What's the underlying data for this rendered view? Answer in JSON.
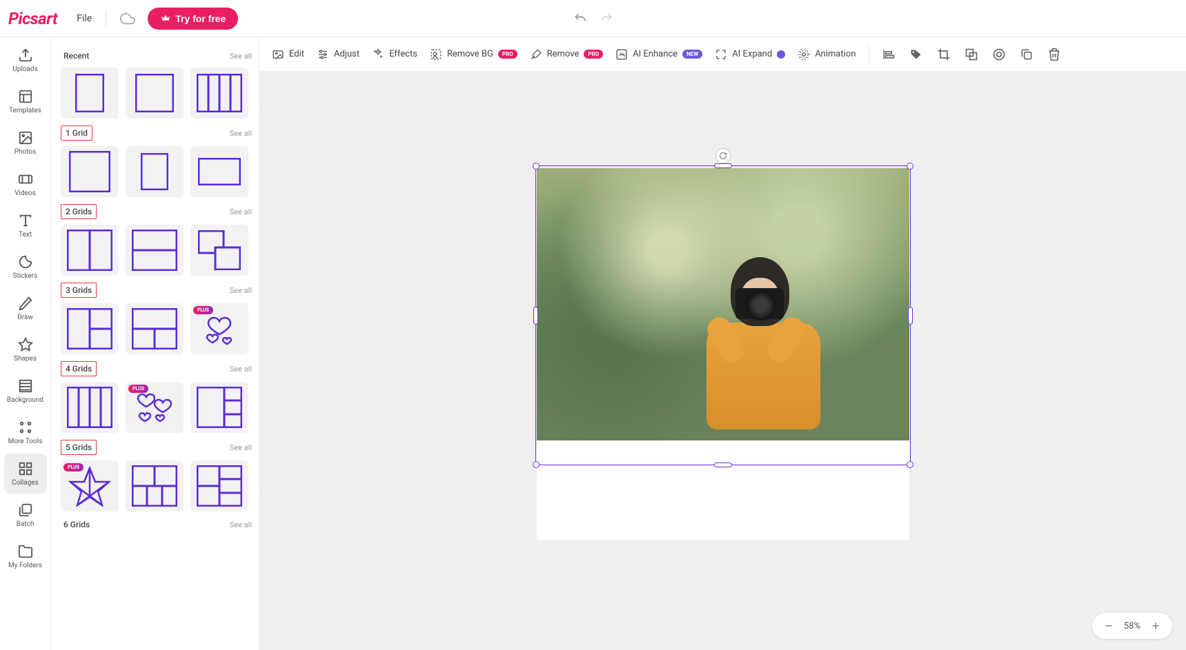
{
  "app": {
    "name": "Picsart"
  },
  "topbar": {
    "file": "File",
    "try_free": "Try for free"
  },
  "rail": {
    "uploads": "Uploads",
    "templates": "Templates",
    "photos": "Photos",
    "videos": "Videos",
    "text": "Text",
    "stickers": "Stickers",
    "draw": "Draw",
    "shapes": "Shapes",
    "background": "Background",
    "more_tools": "More Tools",
    "collages": "Collages",
    "batch": "Batch",
    "my_folders": "My Folders"
  },
  "panel": {
    "see_all": "See all",
    "plus_badge": "PLUS",
    "sections": {
      "recent": "Recent",
      "grid1": "1 Grid",
      "grid2": "2 Grids",
      "grid3": "3 Grids",
      "grid4": "4 Grids",
      "grid5": "5 Grids",
      "grid6": "6 Grids"
    }
  },
  "toolbar": {
    "edit": "Edit",
    "adjust": "Adjust",
    "effects": "Effects",
    "remove_bg": "Remove BG",
    "remove": "Remove",
    "ai_enhance": "AI Enhance",
    "ai_expand": "AI Expand",
    "animation": "Animation",
    "pro": "PRO",
    "new": "NEW"
  },
  "zoom": {
    "value": "58%"
  }
}
